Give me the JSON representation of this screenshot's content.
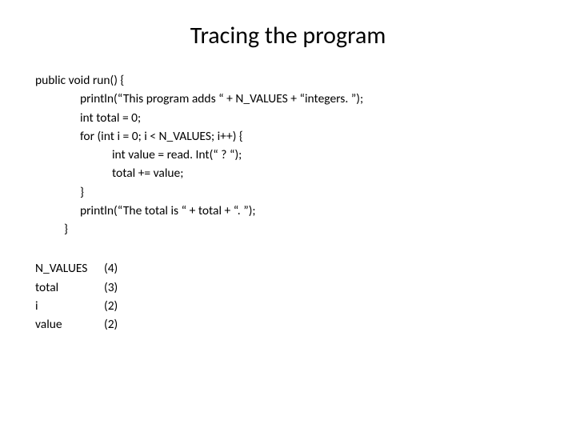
{
  "title": "Tracing the program",
  "code": {
    "l0": "public  void  run() {",
    "l1": "println(“This program adds “ + N_VALUES + “integers. ”);",
    "l2": "int  total = 0;",
    "l3": "for (int i = 0; i < N_VALUES; i++) {",
    "l4": "int  value = read. Int(“  ?  “);",
    "l5": "total += value;",
    "l6": "}",
    "l7": "println(“The total is  “ + total + “. ”);",
    "l8": "}"
  },
  "trace": {
    "r0": {
      "label": "N_VALUES",
      "val": "(4)"
    },
    "r1": {
      "label": "total",
      "val": "(3)"
    },
    "r2": {
      "label": "i",
      "val": "(2)"
    },
    "r3": {
      "label": "value",
      "val": "(2)"
    }
  }
}
